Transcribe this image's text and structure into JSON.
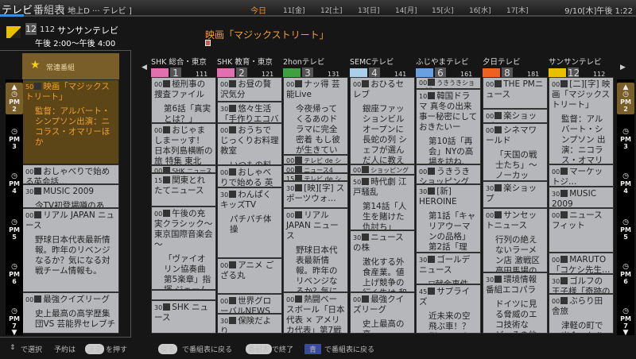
{
  "header": {
    "app": "テレビ",
    "guide": "番組表",
    "source": "[ 地上D ··· テレビ ]",
    "days": [
      "今日",
      "11[金]",
      "12[土]",
      "13[日]",
      "14[月]",
      "15[火]",
      "16[水]",
      "17[木]"
    ],
    "clock": "9/10[木]午後 1:22"
  },
  "info": {
    "num": "12",
    "channel_no": "112",
    "channel_name": "サンサンテレビ",
    "time": "午後 2:00～午後 4:00",
    "program": "映画「マジックストリート」"
  },
  "favorites": {
    "label": "常連番組",
    "programs": [
      {
        "time": "50",
        "title": "映画「マジックストリート」",
        "desc": "監督：アルバート・シンプソン出演：ニコラス・オマリーほか"
      },
      {
        "time": "00",
        "title": "おしゃべりで始める英会話…",
        "desc": ""
      },
      {
        "time": "30",
        "title": "MUSIC 2009",
        "desc": "今TV初登場噂のあの…"
      },
      {
        "time": "00",
        "title": "リアル JAPAN ニュース",
        "desc": "野球日本代表最新情報。昨年のリベンジなるか？気になる対戦チーム情報も。"
      },
      {
        "time": "00",
        "title": "最強クイズリーグ",
        "desc": "史上最高の高学歴集団VS 芸能界セレブチー…"
      }
    ]
  },
  "time_labels": [
    {
      "ampm": "PM",
      "hour": "2"
    },
    {
      "ampm": "PM",
      "hour": "3"
    },
    {
      "ampm": "PM",
      "hour": "4"
    },
    {
      "ampm": "PM",
      "hour": "5"
    },
    {
      "ampm": "PM",
      "hour": "6"
    },
    {
      "ampm": "PM",
      "hour": "7"
    }
  ],
  "columns": [
    {
      "name": "SHK 総合・東京",
      "num": "1",
      "ch": "111",
      "color": "#e070b0",
      "programs": [
        {
          "time": "00",
          "title": "極刑事の捜査ファイル",
          "desc": "第6話「真実とは？」"
        },
        {
          "time": "00",
          "title": "おじゃましまーッす！ 日本列島横断の旅 特集 東北か…",
          "desc": ""
        },
        {
          "time": "00",
          "title": "SHK ニュース",
          "desc": ""
        },
        {
          "time": "15",
          "title": "関東とれたてニュース",
          "desc": ""
        },
        {
          "time": "00",
          "title": "午後の充実クラシック～東京国際音楽会～",
          "desc": "「ヴァイオリン協奏曲 第5楽章」指揮 ジェームス・ペン"
        },
        {
          "time": "",
          "title": "",
          "desc": ""
        },
        {
          "time": "30",
          "title": "SHK ニュース",
          "desc": ""
        }
      ]
    },
    {
      "name": "SHK 教育・東京",
      "num": "2",
      "ch": "121",
      "color": "#e070b0",
      "programs": [
        {
          "time": "00",
          "title": "お昼の贅沢気分",
          "desc": ""
        },
        {
          "time": "30",
          "title": "悠々生活「手作りエコバック」",
          "desc": ""
        },
        {
          "time": "00",
          "title": "おうちでじっくりお料理教室",
          "desc": "いつもの料理…"
        },
        {
          "time": "00",
          "title": "おしゃべりで始める 英会話…",
          "desc": ""
        },
        {
          "time": "30",
          "title": "わんぱくキッズTV",
          "desc": "パチパチ体操"
        },
        {
          "time": "00",
          "title": "アニメ ござる丸",
          "desc": ""
        },
        {
          "time": "00",
          "title": "世界グローバルNEWS",
          "desc": ""
        },
        {
          "time": "30",
          "title": "保険だより",
          "desc": ""
        }
      ]
    },
    {
      "name": "2honテレビ",
      "num": "3",
      "ch": "131",
      "color": "#40a040",
      "programs": [
        {
          "time": "00",
          "title": "ナッ得 芸能Live",
          "desc": "今夜帰ってくるあのドラマに完全密着 もし彼が生きていたら世界は…"
        },
        {
          "time": "00",
          "title": "テレビ de ショッピ…",
          "desc": ""
        },
        {
          "time": "00",
          "title": "ニュース4",
          "desc": ""
        },
        {
          "time": "15",
          "title": "テレビ de ショッピ…",
          "desc": ""
        },
        {
          "time": "30",
          "title": "[映][字] スポーツウォ…",
          "desc": ""
        },
        {
          "time": "00",
          "title": "リアル JAPAN ニュース",
          "desc": "野球日本代表最新情報。昨年のリベンジなるか？気になる対戦チーム情報も。"
        },
        {
          "time": "00",
          "title": "熱闘ベースボール「日本代表 × アメリカ代表」第7戦",
          "desc": ""
        }
      ]
    },
    {
      "name": "SEMCテレビ",
      "num": "4",
      "ch": "141",
      "color": "#a8d0e8",
      "programs": [
        {
          "time": "00",
          "title": "おひるセレブ",
          "desc": "銀座ファッションビルオープンに長蛇の列 シェフが選んだ人に教えたくない店ベスト10"
        },
        {
          "time": "00",
          "title": "ショッピング Life",
          "desc": ""
        },
        {
          "time": "50",
          "title": "時代劇 江戸騒乱",
          "desc": "第14話「人生を賭けた仇討ち」"
        },
        {
          "time": "30",
          "title": "ニュースの株",
          "desc": "激化する外食産業。値上げ競争の行く先は 和食×洋食フ…"
        },
        {
          "time": "00",
          "title": "最強クイズリーグ",
          "desc": "史上最高の高…"
        }
      ]
    },
    {
      "name": "ふじやまテレビ",
      "num": "6",
      "ch": "161",
      "color": "#6aa0e0",
      "programs": [
        {
          "time": "00",
          "title": "うきうきショッピ…",
          "desc": ""
        },
        {
          "time": "10",
          "title": "韓国ドラマ 真冬の出来事ー秘密にしておきたいー",
          "desc": "第10話「再会」NYの高場を訪ね、ひとりで…"
        },
        {
          "time": "00",
          "title": "うきうきショッピング ～今日から始めるダ…",
          "desc": ""
        },
        {
          "time": "30",
          "title": "[新] HEROINE",
          "desc": "第1話「キャリアウーマンの品格」第2話「理想…"
        },
        {
          "time": "30",
          "title": "ゴールデニュース",
          "desc": "▽献金事件の…"
        },
        {
          "time": "45",
          "title": "サプライズ",
          "desc": "近未来の空飛ぶ車！？ 例のアノ人に…"
        }
      ]
    },
    {
      "name": "夕日テレビ",
      "num": "8",
      "ch": "181",
      "color": "#f06020",
      "programs": [
        {
          "time": "00",
          "title": "THE PMニュース",
          "desc": ""
        },
        {
          "time": "00",
          "title": "楽ショップ",
          "desc": ""
        },
        {
          "time": "00",
          "title": "シネマワールド",
          "desc": "「天国の戦士たち」～ノーカット…"
        },
        {
          "time": "30",
          "title": "楽ショップ",
          "desc": ""
        },
        {
          "time": "00",
          "title": "サンセットニュース",
          "desc": "行列の絶えないラーメン店 激戦区高田馬場の名店に密着…"
        },
        {
          "time": "30",
          "title": "環境情報番組エコパラ",
          "desc": "ドイツに見る脅威のエコ技術など、その他ー…"
        }
      ]
    },
    {
      "name": "サンサンテレビ",
      "num": "12",
      "ch": "112",
      "color": "#e8c000",
      "programs": [
        {
          "time": "00",
          "title": "[二][字] 映画「マジックストリート」",
          "desc": "監督：アルバート・シンプソン 出演：ニコラス・オマリーほか"
        },
        {
          "time": "00",
          "title": "マーケットジ…",
          "desc": ""
        },
        {
          "time": "30",
          "title": "MUSIC 2009",
          "desc": ""
        },
        {
          "time": "00",
          "title": "ニュースフィット",
          "desc": ""
        },
        {
          "time": "00",
          "title": "MARUTO「コケシ先生…",
          "desc": ""
        },
        {
          "time": "30",
          "title": "ゴルフの王子様「奇跡の一打」",
          "desc": ""
        },
        {
          "time": "00",
          "title": "ぶらり田舎旅",
          "desc": "津軽の町で出会ったあったか…"
        }
      ]
    }
  ],
  "footer": {
    "select": "で選択",
    "reserve_pre": "予約は",
    "reserve_key": "決定",
    "reserve_post": "を押す",
    "back_key": "戻る",
    "back": "で番組表に戻る",
    "guide_key": "番組表",
    "exit": "で終了",
    "blue_key": "青",
    "blue": "で番組表に戻る"
  }
}
